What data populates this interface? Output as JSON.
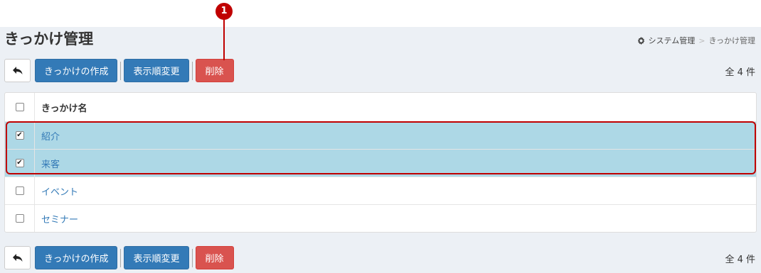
{
  "page_title": "きっかけ管理",
  "breadcrumb": {
    "parent": "システム管理",
    "separator": ">",
    "current": "きっかけ管理"
  },
  "marker": {
    "label": "1",
    "color": "#c00000"
  },
  "toolbar": {
    "create_label": "きっかけの作成",
    "reorder_label": "表示順変更",
    "delete_label": "削除"
  },
  "count_label": "全 4 件",
  "table": {
    "header": "きっかけ名",
    "rows": [
      {
        "name": "紹介",
        "checked": true
      },
      {
        "name": "来客",
        "checked": true
      },
      {
        "name": "イベント",
        "checked": false
      },
      {
        "name": "セミナー",
        "checked": false
      }
    ]
  },
  "colors": {
    "primary": "#337ab7",
    "danger": "#d9534f",
    "selected_row": "#add8e6",
    "highlight": "#c00000",
    "background": "#ecf0f5"
  },
  "icons": {
    "back": "reply-arrow-icon",
    "breadcrumb": "gear-icon"
  }
}
